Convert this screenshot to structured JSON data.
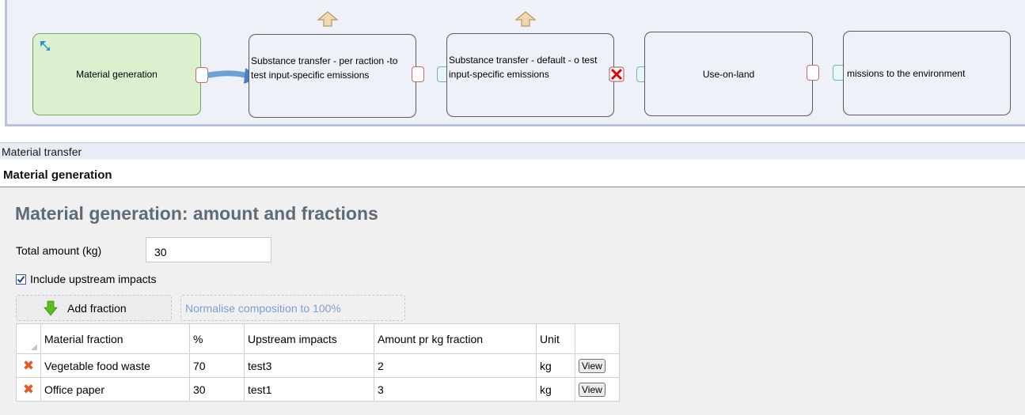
{
  "flow": {
    "nodes": [
      {
        "label": "Material generation",
        "active": true
      },
      {
        "label": "Substance transfer - per raction -to test input-specific emissions"
      },
      {
        "label": "Substance transfer - default - o test input-specific emissions"
      },
      {
        "label": "Use-on-land"
      },
      {
        "label": "missions to the environment"
      }
    ]
  },
  "section": {
    "label": "Material transfer"
  },
  "subheader": {
    "title": "Material generation"
  },
  "page": {
    "title": "Material generation: amount and fractions"
  },
  "form": {
    "total_label": "Total amount (kg)",
    "total_value": "30",
    "include_upstream_label": "Include upstream impacts",
    "include_upstream_checked": true
  },
  "toolbar": {
    "add_fraction_label": "Add fraction",
    "normalise_label": "Normalise composition to 100%"
  },
  "grid": {
    "columns": [
      "Material fraction",
      "%",
      "Upstream impacts",
      "Amount pr kg fraction",
      "Unit"
    ],
    "rows": [
      {
        "fraction": "Vegetable food waste",
        "percent": "70",
        "upstream": "test3",
        "amount": "2",
        "unit": "kg",
        "action": "View"
      },
      {
        "fraction": "Office paper",
        "percent": "30",
        "upstream": "test1",
        "amount": "3",
        "unit": "kg",
        "action": "View"
      }
    ]
  },
  "colors": {
    "active_node": "#dbf0cf",
    "node_bg": "#eef1f8",
    "title": "#5f6b77",
    "link": "#7d9cd8",
    "delete": "#e35b1e",
    "error": "#e00000"
  }
}
